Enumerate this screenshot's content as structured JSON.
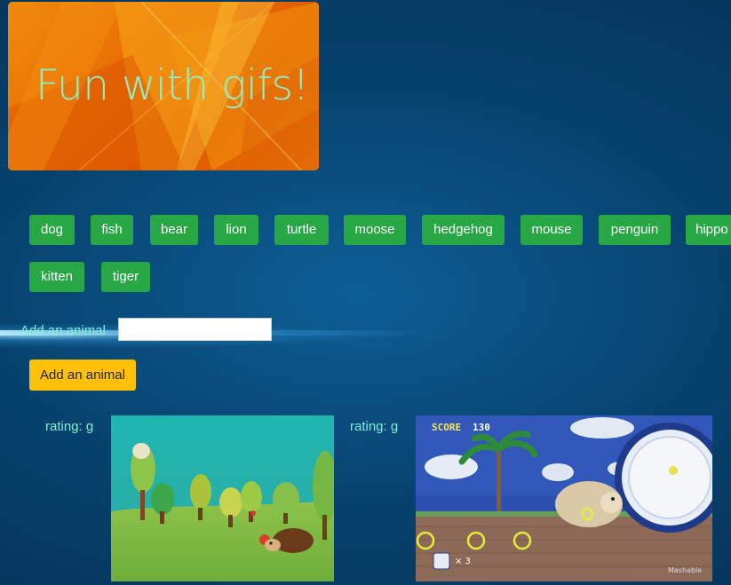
{
  "header": {
    "title": "Fun with gifs!"
  },
  "animal_buttons": [
    "dog",
    "fish",
    "bear",
    "lion",
    "turtle",
    "moose",
    "hedgehog",
    "mouse",
    "penguin",
    "hippo",
    "kitten",
    "tiger"
  ],
  "form": {
    "label": "Add an animal",
    "input_value": "",
    "submit_label": "Add an animal"
  },
  "results": [
    {
      "rating": "rating: g",
      "subject": "knitted hedgehog and trees"
    },
    {
      "rating": "rating: g",
      "subject": "hedgehog game",
      "score_label": "SCORE",
      "score_value": "130",
      "lives": "× 3",
      "watermark": "Mashable"
    }
  ],
  "colors": {
    "button_green": "#28a745",
    "button_yellow": "#ffc107",
    "label_text": "#7ff0d6",
    "title_text": "#8ff0c8",
    "jumbotron_orange": "#e86d05"
  }
}
